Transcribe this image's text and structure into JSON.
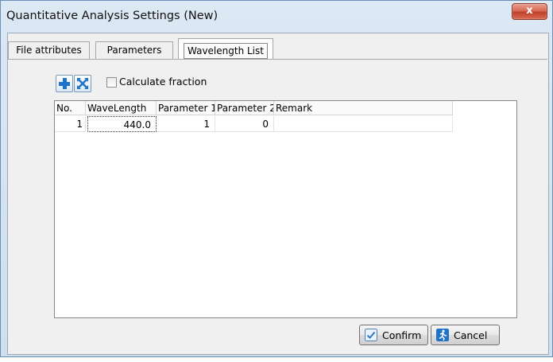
{
  "window": {
    "title": "Quantitative Analysis Settings (New)",
    "close_glyph": "x"
  },
  "tabs": [
    {
      "label": "File attributes",
      "active": false
    },
    {
      "label": "Parameters",
      "active": false
    },
    {
      "label": "Wavelength List",
      "active": true
    }
  ],
  "toolbar": {
    "add_icon": "plus-icon",
    "remove_icon": "cross-arrows-icon",
    "calculate_fraction_label": "Calculate fraction",
    "calculate_fraction_checked": false
  },
  "table": {
    "columns": [
      "No.",
      "WaveLength",
      "Parameter 1",
      "Parameter 2",
      "Remark"
    ],
    "rows": [
      {
        "no": "1",
        "wavelength": "440.0",
        "parameter1": "1",
        "parameter2": "0",
        "remark": ""
      }
    ]
  },
  "buttons": {
    "confirm_label": "Confirm",
    "cancel_label": "Cancel"
  },
  "colors": {
    "accent_blue": "#1e73c8",
    "close_red": "#c0402a"
  }
}
